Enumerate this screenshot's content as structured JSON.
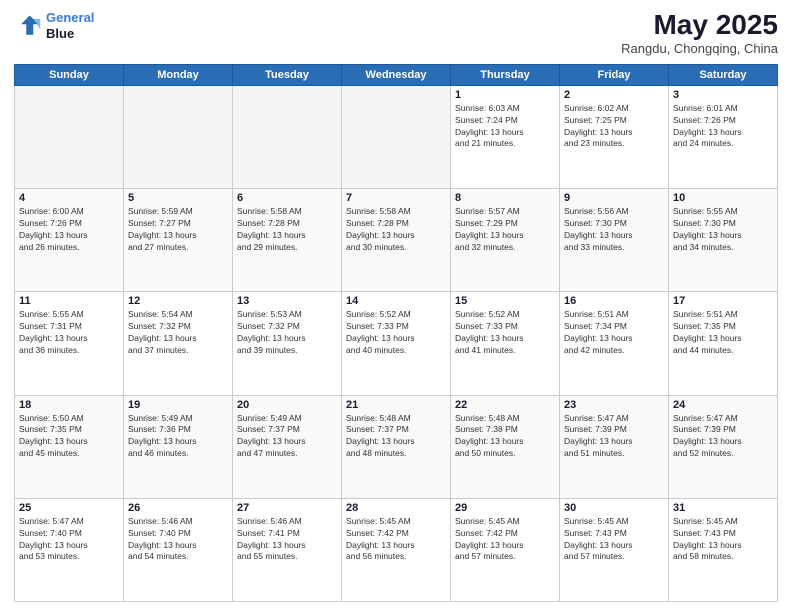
{
  "header": {
    "logo_line1": "General",
    "logo_line2": "Blue",
    "month": "May 2025",
    "location": "Rangdu, Chongqing, China"
  },
  "days_of_week": [
    "Sunday",
    "Monday",
    "Tuesday",
    "Wednesday",
    "Thursday",
    "Friday",
    "Saturday"
  ],
  "weeks": [
    [
      {
        "day": "",
        "info": ""
      },
      {
        "day": "",
        "info": ""
      },
      {
        "day": "",
        "info": ""
      },
      {
        "day": "",
        "info": ""
      },
      {
        "day": "1",
        "info": "Sunrise: 6:03 AM\nSunset: 7:24 PM\nDaylight: 13 hours\nand 21 minutes."
      },
      {
        "day": "2",
        "info": "Sunrise: 6:02 AM\nSunset: 7:25 PM\nDaylight: 13 hours\nand 23 minutes."
      },
      {
        "day": "3",
        "info": "Sunrise: 6:01 AM\nSunset: 7:26 PM\nDaylight: 13 hours\nand 24 minutes."
      }
    ],
    [
      {
        "day": "4",
        "info": "Sunrise: 6:00 AM\nSunset: 7:26 PM\nDaylight: 13 hours\nand 26 minutes."
      },
      {
        "day": "5",
        "info": "Sunrise: 5:59 AM\nSunset: 7:27 PM\nDaylight: 13 hours\nand 27 minutes."
      },
      {
        "day": "6",
        "info": "Sunrise: 5:58 AM\nSunset: 7:28 PM\nDaylight: 13 hours\nand 29 minutes."
      },
      {
        "day": "7",
        "info": "Sunrise: 5:58 AM\nSunset: 7:28 PM\nDaylight: 13 hours\nand 30 minutes."
      },
      {
        "day": "8",
        "info": "Sunrise: 5:57 AM\nSunset: 7:29 PM\nDaylight: 13 hours\nand 32 minutes."
      },
      {
        "day": "9",
        "info": "Sunrise: 5:56 AM\nSunset: 7:30 PM\nDaylight: 13 hours\nand 33 minutes."
      },
      {
        "day": "10",
        "info": "Sunrise: 5:55 AM\nSunset: 7:30 PM\nDaylight: 13 hours\nand 34 minutes."
      }
    ],
    [
      {
        "day": "11",
        "info": "Sunrise: 5:55 AM\nSunset: 7:31 PM\nDaylight: 13 hours\nand 36 minutes."
      },
      {
        "day": "12",
        "info": "Sunrise: 5:54 AM\nSunset: 7:32 PM\nDaylight: 13 hours\nand 37 minutes."
      },
      {
        "day": "13",
        "info": "Sunrise: 5:53 AM\nSunset: 7:32 PM\nDaylight: 13 hours\nand 39 minutes."
      },
      {
        "day": "14",
        "info": "Sunrise: 5:52 AM\nSunset: 7:33 PM\nDaylight: 13 hours\nand 40 minutes."
      },
      {
        "day": "15",
        "info": "Sunrise: 5:52 AM\nSunset: 7:33 PM\nDaylight: 13 hours\nand 41 minutes."
      },
      {
        "day": "16",
        "info": "Sunrise: 5:51 AM\nSunset: 7:34 PM\nDaylight: 13 hours\nand 42 minutes."
      },
      {
        "day": "17",
        "info": "Sunrise: 5:51 AM\nSunset: 7:35 PM\nDaylight: 13 hours\nand 44 minutes."
      }
    ],
    [
      {
        "day": "18",
        "info": "Sunrise: 5:50 AM\nSunset: 7:35 PM\nDaylight: 13 hours\nand 45 minutes."
      },
      {
        "day": "19",
        "info": "Sunrise: 5:49 AM\nSunset: 7:36 PM\nDaylight: 13 hours\nand 46 minutes."
      },
      {
        "day": "20",
        "info": "Sunrise: 5:49 AM\nSunset: 7:37 PM\nDaylight: 13 hours\nand 47 minutes."
      },
      {
        "day": "21",
        "info": "Sunrise: 5:48 AM\nSunset: 7:37 PM\nDaylight: 13 hours\nand 48 minutes."
      },
      {
        "day": "22",
        "info": "Sunrise: 5:48 AM\nSunset: 7:38 PM\nDaylight: 13 hours\nand 50 minutes."
      },
      {
        "day": "23",
        "info": "Sunrise: 5:47 AM\nSunset: 7:39 PM\nDaylight: 13 hours\nand 51 minutes."
      },
      {
        "day": "24",
        "info": "Sunrise: 5:47 AM\nSunset: 7:39 PM\nDaylight: 13 hours\nand 52 minutes."
      }
    ],
    [
      {
        "day": "25",
        "info": "Sunrise: 5:47 AM\nSunset: 7:40 PM\nDaylight: 13 hours\nand 53 minutes."
      },
      {
        "day": "26",
        "info": "Sunrise: 5:46 AM\nSunset: 7:40 PM\nDaylight: 13 hours\nand 54 minutes."
      },
      {
        "day": "27",
        "info": "Sunrise: 5:46 AM\nSunset: 7:41 PM\nDaylight: 13 hours\nand 55 minutes."
      },
      {
        "day": "28",
        "info": "Sunrise: 5:45 AM\nSunset: 7:42 PM\nDaylight: 13 hours\nand 56 minutes."
      },
      {
        "day": "29",
        "info": "Sunrise: 5:45 AM\nSunset: 7:42 PM\nDaylight: 13 hours\nand 57 minutes."
      },
      {
        "day": "30",
        "info": "Sunrise: 5:45 AM\nSunset: 7:43 PM\nDaylight: 13 hours\nand 57 minutes."
      },
      {
        "day": "31",
        "info": "Sunrise: 5:45 AM\nSunset: 7:43 PM\nDaylight: 13 hours\nand 58 minutes."
      }
    ]
  ]
}
